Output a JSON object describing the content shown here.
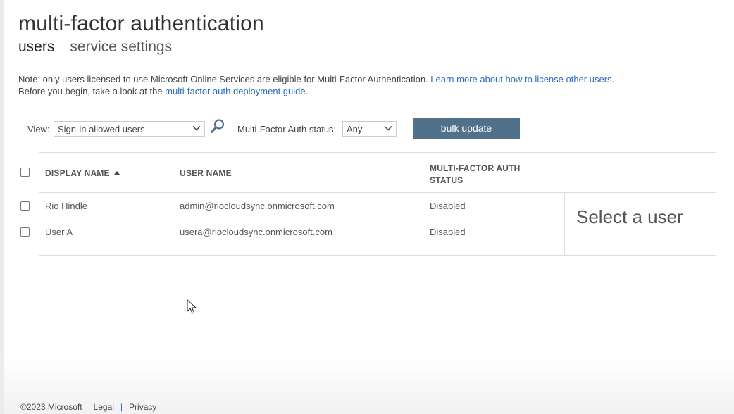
{
  "page": {
    "title": "multi-factor authentication",
    "tabs": [
      {
        "label": "users",
        "active": true
      },
      {
        "label": "service settings",
        "active": false
      }
    ]
  },
  "note": {
    "line1_text": "Note: only users licensed to use Microsoft Online Services are eligible for Multi-Factor Authentication.",
    "line1_link": "Learn more about how to license other users.",
    "line2_text": "Before you begin, take a look at the",
    "line2_link": "multi-factor auth deployment guide.",
    "link_color": "#2a6ebb"
  },
  "filters": {
    "view_label": "View:",
    "view_selected": "Sign-in allowed users",
    "mfa_status_label": "Multi-Factor Auth status:",
    "mfa_status_selected": "Any",
    "bulk_update_label": "bulk update",
    "button_color": "#51718a"
  },
  "table": {
    "columns": [
      {
        "label": "DISPLAY NAME",
        "sort": "ascending"
      },
      {
        "label": "USER NAME"
      },
      {
        "label": "MULTI-FACTOR AUTH STATUS",
        "line1": "MULTI-FACTOR AUTH",
        "line2": "STATUS"
      }
    ],
    "rows": [
      {
        "display_name": "Rio Hindle",
        "user_name": "admin@riocloudsync.onmicrosoft.com",
        "mfa_status": "Disabled"
      },
      {
        "display_name": "User A",
        "user_name": "usera@riocloudsync.onmicrosoft.com",
        "mfa_status": "Disabled"
      }
    ],
    "detail_placeholder": "Select a user"
  },
  "footer": {
    "copyright": "©2023 Microsoft",
    "legal": "Legal",
    "separator": "|",
    "privacy": "Privacy"
  }
}
